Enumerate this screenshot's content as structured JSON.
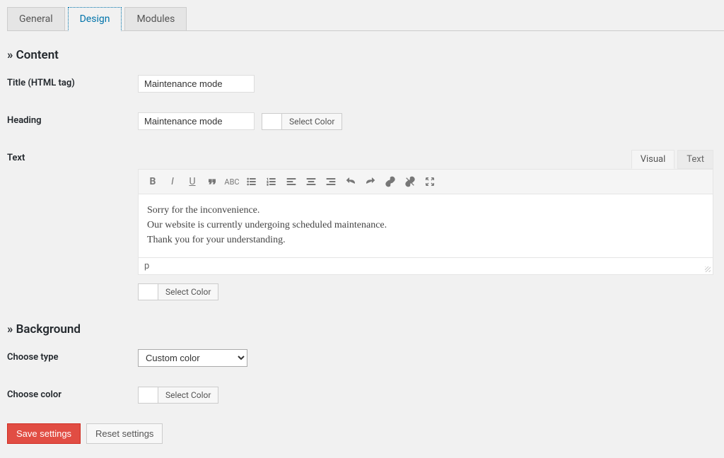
{
  "tabs": [
    {
      "label": "General",
      "active": false
    },
    {
      "label": "Design",
      "active": true
    },
    {
      "label": "Modules",
      "active": false
    }
  ],
  "sections": {
    "content": {
      "heading": "» Content"
    },
    "background": {
      "heading": "» Background"
    }
  },
  "fields": {
    "title": {
      "label": "Title (HTML tag)",
      "value": "Maintenance mode"
    },
    "heading": {
      "label": "Heading",
      "value": "Maintenance mode",
      "color_button": "Select Color"
    },
    "text": {
      "label": "Text",
      "editor_tabs": {
        "visual": "Visual",
        "text": "Text"
      },
      "body_line1": "Sorry for the inconvenience.",
      "body_line2": "Our website is currently undergoing scheduled maintenance.",
      "body_line3": "Thank you for your understanding.",
      "path": "p",
      "color_button": "Select Color"
    },
    "bg_type": {
      "label": "Choose type",
      "value": "Custom color"
    },
    "bg_color": {
      "label": "Choose color",
      "color_button": "Select Color"
    }
  },
  "buttons": {
    "save": "Save settings",
    "reset": "Reset settings"
  },
  "colors": {
    "accent": "#0073aa",
    "primary_btn": "#e14d43"
  }
}
